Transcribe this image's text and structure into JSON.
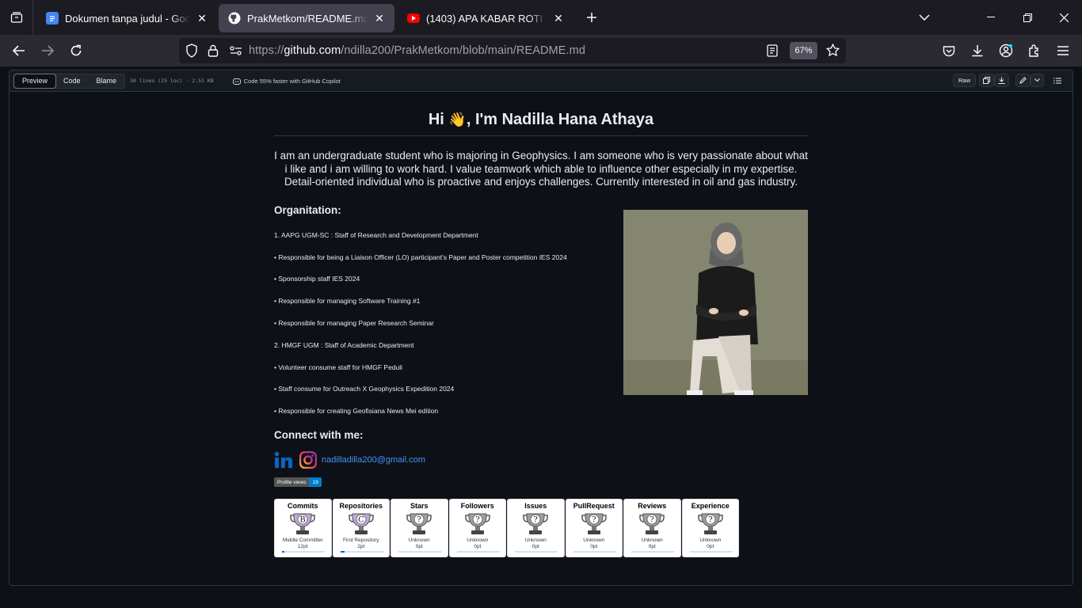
{
  "browser": {
    "tabs": [
      {
        "title": "Dokumen tanpa judul - Google Dokumen",
        "favicon": "google-docs-icon",
        "active": false
      },
      {
        "title": "PrakMetkom/README.md at main",
        "favicon": "github-icon",
        "active": true
      },
      {
        "title": "(1403) APA KABAR ROTI BAKAR",
        "favicon": "youtube-icon",
        "active": false
      }
    ],
    "url_prefix": "https://",
    "url_host": "github.com",
    "url_path": "/ndilla200/PrakMetkom/blob/main/README.md",
    "zoom": "67%"
  },
  "file_header": {
    "modes": [
      "Preview",
      "Code",
      "Blame"
    ],
    "active_mode": "Preview",
    "meta": "30 lines (25 loc) · 2.51 KB",
    "copilot": "Code 55% faster with GitHub Copilot",
    "raw_label": "Raw"
  },
  "readme": {
    "title_pre": "Hi",
    "title_emoji": "👋",
    "title_post": ", I'm Nadilla Hana Athaya",
    "intro": "I am an undergraduate student who is majoring in Geophysics. I am someone who is very passionate about what i like and i am willing to work hard. I value teamwork which able to influence other especially in my expertise. Detail-oriented individual who is proactive and enjoys challenges. Currently interested in oil and gas industry.",
    "org_heading": "Organitation:",
    "org_items": [
      "1. AAPG UGM-SC : Staff of Research and Development Department",
      "• Responsible for being a Liaison Officer (LO) participant's Paper and Poster competition IES 2024",
      "• Sponsorship staff IES 2024",
      "• Responsible for managing Software Training #1",
      "• Responsible for managing Paper Research Seminar",
      "2. HMGF UGM : Staff of Academic Department",
      "• Volunteer consume staff for HMGF Peduli",
      "• Staff consume for Outreach X Geophysics Expedition 2024",
      "• Responsible for creating Geofisiana News Mei edition"
    ],
    "connect_heading": "Connect with me:",
    "email": "nadilladilla200@gmail.com",
    "views_label": "Profile views",
    "views_count": "19",
    "trophies": [
      {
        "title": "Commits",
        "rank": "B",
        "label": "Middle Committer",
        "points": "12pt",
        "progress": 0.05,
        "color": "#c0a6e0"
      },
      {
        "title": "Repositories",
        "rank": "C",
        "label": "First Repository",
        "points": "2pt",
        "progress": 0.1,
        "color": "#c0a6e0"
      },
      {
        "title": "Stars",
        "rank": "?",
        "label": "Unknown",
        "points": "0pt",
        "progress": 0,
        "color": "#9e9e9e"
      },
      {
        "title": "Followers",
        "rank": "?",
        "label": "Unknown",
        "points": "0pt",
        "progress": 0,
        "color": "#9e9e9e"
      },
      {
        "title": "Issues",
        "rank": "?",
        "label": "Unknown",
        "points": "0pt",
        "progress": 0,
        "color": "#9e9e9e"
      },
      {
        "title": "PullRequest",
        "rank": "?",
        "label": "Unknown",
        "points": "0pt",
        "progress": 0,
        "color": "#9e9e9e"
      },
      {
        "title": "Reviews",
        "rank": "?",
        "label": "Unknown",
        "points": "0pt",
        "progress": 0,
        "color": "#9e9e9e"
      },
      {
        "title": "Experience",
        "rank": "?",
        "label": "Unknown",
        "points": "0pt",
        "progress": 0,
        "color": "#9e9e9e"
      }
    ]
  }
}
